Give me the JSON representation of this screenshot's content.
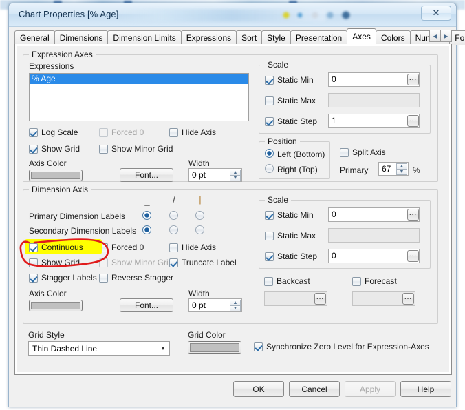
{
  "window": {
    "title": "Chart Properties [% Age]",
    "close_label": "✕"
  },
  "tabs": {
    "items": [
      {
        "label": "General",
        "selected": false
      },
      {
        "label": "Dimensions",
        "selected": false
      },
      {
        "label": "Dimension Limits",
        "selected": false
      },
      {
        "label": "Expressions",
        "selected": false
      },
      {
        "label": "Sort",
        "selected": false
      },
      {
        "label": "Style",
        "selected": false
      },
      {
        "label": "Presentation",
        "selected": false
      },
      {
        "label": "Axes",
        "selected": true
      },
      {
        "label": "Colors",
        "selected": false
      },
      {
        "label": "Number",
        "selected": false
      },
      {
        "label": "Font",
        "selected": false
      }
    ],
    "nav_prev": "◀",
    "nav_next": "▶"
  },
  "expression_axes": {
    "group_label": "Expression Axes",
    "expressions_label": "Expressions",
    "list": [
      {
        "label": "% Age",
        "selected": true
      }
    ],
    "log_scale": {
      "label": "Log Scale",
      "checked": true,
      "disabled": false
    },
    "forced_0": {
      "label": "Forced 0",
      "checked": false,
      "disabled": true
    },
    "hide_axis": {
      "label": "Hide Axis",
      "checked": false,
      "disabled": false
    },
    "show_grid": {
      "label": "Show Grid",
      "checked": true,
      "disabled": false
    },
    "show_minor_grid": {
      "label": "Show Minor Grid",
      "checked": false,
      "disabled": false
    },
    "axis_color_label": "Axis Color",
    "font_button": "Font...",
    "width_label": "Width",
    "width_value": "0 pt",
    "spin_up": "▲",
    "spin_down": "▼",
    "scale": {
      "group_label": "Scale",
      "static_min": {
        "label": "Static Min",
        "checked": true,
        "value": "0",
        "dots": "..."
      },
      "static_max": {
        "label": "Static Max",
        "checked": false,
        "value": "",
        "dots": "..."
      },
      "static_step": {
        "label": "Static Step",
        "checked": true,
        "value": "1",
        "dots": "..."
      }
    },
    "position": {
      "group_label": "Position",
      "left_bottom": {
        "label": "Left (Bottom)",
        "selected": true
      },
      "right_top": {
        "label": "Right (Top)",
        "selected": false
      },
      "split_axis": {
        "label": "Split Axis",
        "checked": false
      },
      "primary_label": "Primary",
      "primary_value": "67",
      "percent_sign": "%"
    }
  },
  "dimension_axis": {
    "group_label": "Dimension Axis",
    "symbol_headers": [
      "_",
      "/",
      "|"
    ],
    "primary_labels": {
      "label": "Primary Dimension Labels",
      "selected_index": 0
    },
    "secondary_labels": {
      "label": "Secondary Dimension Labels",
      "selected_index": 0
    },
    "continuous": {
      "label": "Continuous",
      "checked": true,
      "highlighted": true
    },
    "forced_0": {
      "label": "Forced 0",
      "checked": false,
      "disabled": false
    },
    "hide_axis": {
      "label": "Hide Axis",
      "checked": false,
      "disabled": false
    },
    "show_grid": {
      "label": "Show Grid",
      "checked": false,
      "disabled": false
    },
    "show_minor_grid": {
      "label": "Show Minor Grid",
      "checked": false,
      "disabled": true
    },
    "truncate_label": {
      "label": "Truncate Label",
      "checked": true,
      "disabled": false
    },
    "stagger_labels": {
      "label": "Stagger Labels",
      "checked": true,
      "disabled": false
    },
    "reverse_stagger": {
      "label": "Reverse Stagger",
      "checked": false,
      "disabled": false
    },
    "axis_color_label": "Axis Color",
    "font_button": "Font...",
    "width_label": "Width",
    "width_value": "0 pt",
    "scale": {
      "group_label": "Scale",
      "static_min": {
        "label": "Static Min",
        "checked": true,
        "value": "0",
        "dots": "..."
      },
      "static_max": {
        "label": "Static Max",
        "checked": false,
        "value": "",
        "dots": "..."
      },
      "static_step": {
        "label": "Static Step",
        "checked": true,
        "value": "0",
        "dots": "..."
      }
    },
    "backcast": {
      "label": "Backcast",
      "checked": false,
      "value": "",
      "dots": "..."
    },
    "forecast": {
      "label": "Forecast",
      "checked": false,
      "value": "",
      "dots": "..."
    }
  },
  "bottom": {
    "grid_style_label": "Grid Style",
    "grid_style_value": "Thin Dashed Line",
    "grid_style_arrow": "▼",
    "grid_color_label": "Grid Color",
    "sync_zero": {
      "label": "Synchronize Zero Level for Expression-Axes",
      "checked": true
    }
  },
  "footer": {
    "ok": "OK",
    "cancel": "Cancel",
    "apply": "Apply",
    "help": "Help",
    "apply_disabled": true
  },
  "annotations": {
    "highlight_color": "#ffff00",
    "circle_color": "#e01b1b",
    "target": "Continuous"
  },
  "colors": {
    "selection_blue": "#2a8ae8",
    "dialog_bg": "#f0f0f0",
    "swatch_gray": "#c0c0c0"
  }
}
